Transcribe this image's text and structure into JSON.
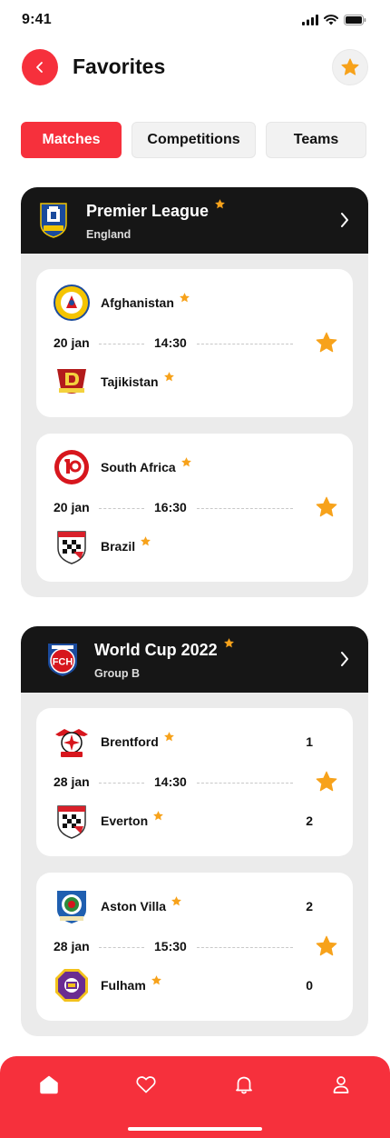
{
  "status": {
    "time": "9:41"
  },
  "header": {
    "title": "Favorites"
  },
  "tabs": [
    {
      "label": "Matches",
      "active": true
    },
    {
      "label": "Competitions",
      "active": false
    },
    {
      "label": "Teams",
      "active": false
    }
  ],
  "leagues": [
    {
      "name": "Premier League",
      "subtitle": "England",
      "matches": [
        {
          "home": {
            "name": "Afghanistan",
            "score": ""
          },
          "away": {
            "name": "Tajikistan",
            "score": ""
          },
          "date": "20 jan",
          "time": "14:30"
        },
        {
          "home": {
            "name": "South Africa",
            "score": ""
          },
          "away": {
            "name": "Brazil",
            "score": ""
          },
          "date": "20 jan",
          "time": "16:30"
        }
      ]
    },
    {
      "name": "World Cup 2022",
      "subtitle": "Group B",
      "matches": [
        {
          "home": {
            "name": "Brentford",
            "score": "1"
          },
          "away": {
            "name": "Everton",
            "score": "2"
          },
          "date": "28 jan",
          "time": "14:30"
        },
        {
          "home": {
            "name": "Aston Villa",
            "score": "2"
          },
          "away": {
            "name": "Fulham",
            "score": "0"
          },
          "date": "28 jan",
          "time": "15:30"
        }
      ]
    }
  ],
  "nav": [
    {
      "icon": "home-icon",
      "active": true
    },
    {
      "icon": "heart-icon",
      "active": false
    },
    {
      "icon": "bell-icon",
      "active": false
    },
    {
      "icon": "profile-icon",
      "active": false
    }
  ],
  "colors": {
    "accent": "#f6303c",
    "star": "#f7a21b",
    "dark": "#161616",
    "card_bg": "#ebebeb"
  },
  "logos": {
    "league_1": "Everton"
  }
}
